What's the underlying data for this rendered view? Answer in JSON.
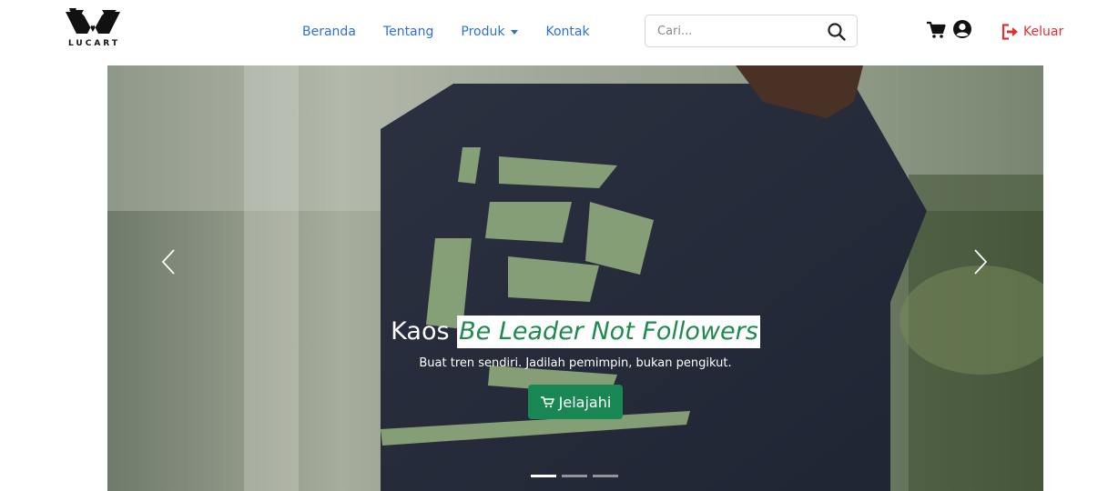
{
  "brand": {
    "name": "LUCART"
  },
  "nav": {
    "links": [
      "Beranda",
      "Tentang",
      "Produk",
      "Kontak"
    ]
  },
  "search": {
    "placeholder": "Cari..."
  },
  "icons": {
    "search": "search-icon",
    "cart": "cart-icon",
    "user": "user-circle-icon",
    "logout": "sign-out-icon",
    "prev": "chevron-left-icon",
    "next": "chevron-right-icon"
  },
  "logout": {
    "label": "Keluar"
  },
  "carousel": {
    "title_prefix": "Kaos",
    "title_highlight": "Be Leader Not Followers",
    "subtitle": "Buat tren sendiri. Jadilah pemimpin, bukan pengikut.",
    "button_label": "Jelajahi",
    "slide_count": 3,
    "active_slide": 1
  },
  "colors": {
    "nav_link": "#2f6fd6",
    "logout": "#e03131",
    "button": "#198754",
    "highlight_text": "#1e8a4f"
  }
}
